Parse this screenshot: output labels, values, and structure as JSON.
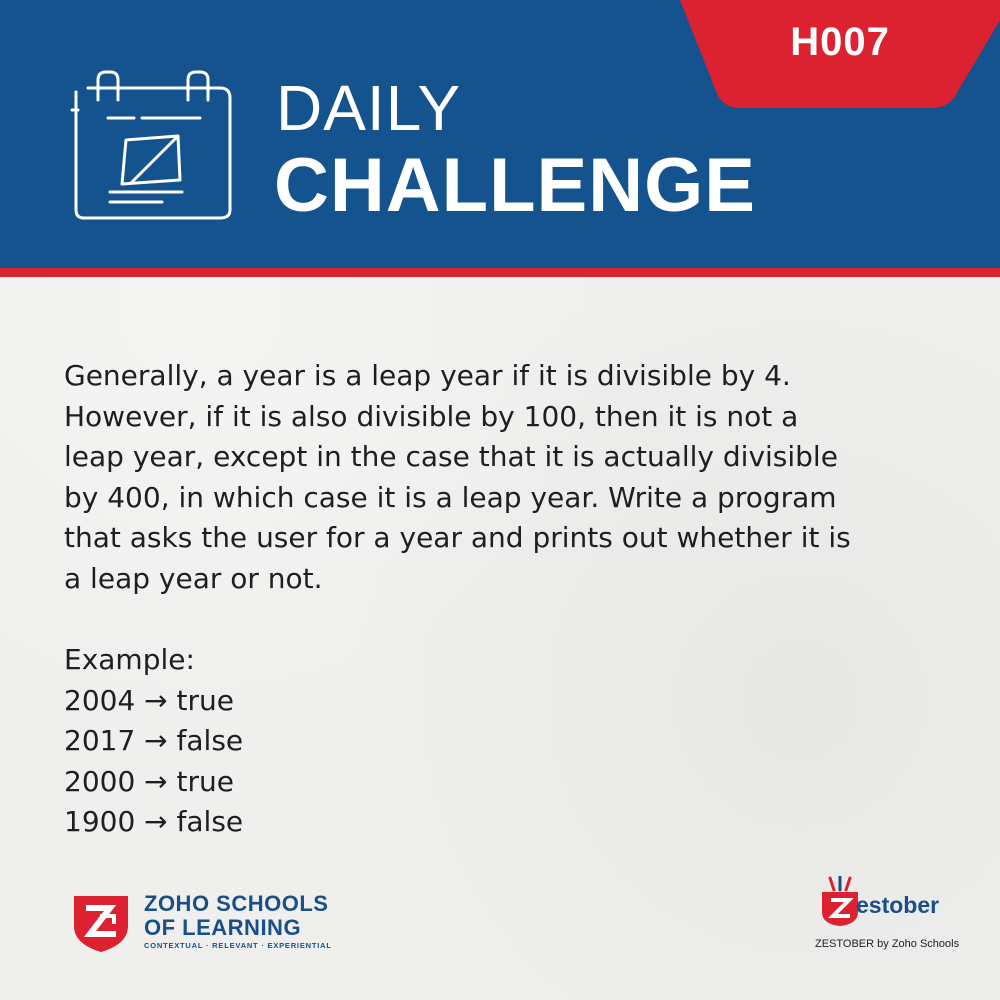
{
  "header": {
    "code": "H007",
    "title_line1": "DAILY",
    "title_line2": "CHALLENGE",
    "icon": "calendar-laptop-icon"
  },
  "colors": {
    "header_blue": "#14538d",
    "accent_red": "#dc2230",
    "text_dark": "#1f1f1f",
    "brand_blue": "#1a4f8a"
  },
  "problem": {
    "lines": [
      "Generally, a year is a leap year if it is divisible by 4.",
      "However, if it is also divisible by 100, then it is not a",
      "leap year, except in the case that it is actually divisible",
      "by 400, in which case it is a leap year. Write a program",
      "that asks the user for a year and prints out whether it is",
      "a leap year or not."
    ]
  },
  "example": {
    "label": "Example:",
    "items": [
      "2004 → true",
      "2017 → false",
      "2000 → true",
      "1900 → false"
    ]
  },
  "footer": {
    "zsl_line1": "ZOHO SCHOOLS",
    "zsl_line2": "OF LEARNING",
    "zsl_tagline": "CONTEXTUAL · RELEVANT · EXPERIENTIAL",
    "zestober_word": "estober",
    "zestober_sub": "ZESTOBER by Zoho Schools"
  }
}
